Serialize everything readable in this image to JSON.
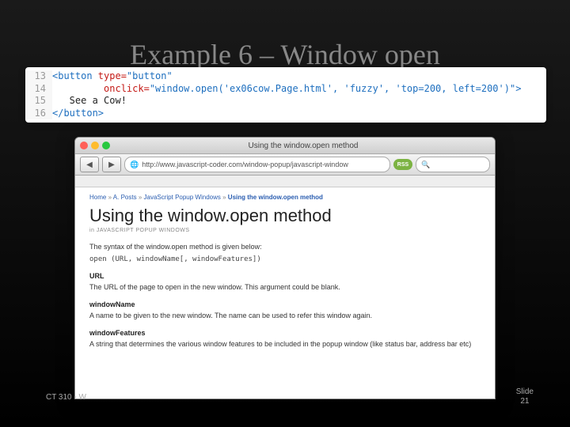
{
  "slide": {
    "title": "Example 6 – Window open",
    "footer_left": "CT 310 - W",
    "footer_right_label": "Slide",
    "footer_right_num": "21"
  },
  "code": {
    "lines": [
      "13",
      "14",
      "15",
      "16"
    ],
    "l13_a": "<button ",
    "l13_b": "type=",
    "l13_c": "\"button\"",
    "l14_a": "         onclick=",
    "l14_b": "\"window.open('ex06cow.Page.html', 'fuzzy', 'top=200, left=200')\"",
    "l14_c": ">",
    "l15": "   See a Cow!",
    "l16": "</button>"
  },
  "browser": {
    "window_title": "Using the window.open method",
    "dots": {
      "red": "#ff5f57",
      "yellow": "#febc2e",
      "green": "#28c840"
    },
    "back": "◀",
    "fwd": "▶",
    "url_icon": "🌐",
    "url": "http://www.javascript-coder.com/window-popup/javascript-window",
    "rss": "RSS",
    "search_icon": "🔍",
    "search_placeholder": ""
  },
  "page": {
    "crumbs": {
      "a": "Home",
      "b": "A. Posts",
      "c": "JavaScript Popup Windows",
      "d": "Using the window.open method",
      "sep": " » "
    },
    "h1": "Using the window.open method",
    "cat": "in JAVASCRIPT POPUP WINDOWS",
    "intro": "The syntax of the window.open method is given below:",
    "syntax": "open (URL, windowName[, windowFeatures])",
    "sections": {
      "url_h": "URL",
      "url_p": "The URL of the page to open in the new window. This argument could be blank.",
      "wn_h": "windowName",
      "wn_p": "A name to be given to the new window. The name can be used to refer this window again.",
      "wf_h": "windowFeatures",
      "wf_p": "A string that determines the various window features to be included in the popup window (like status bar, address bar etc)"
    }
  }
}
